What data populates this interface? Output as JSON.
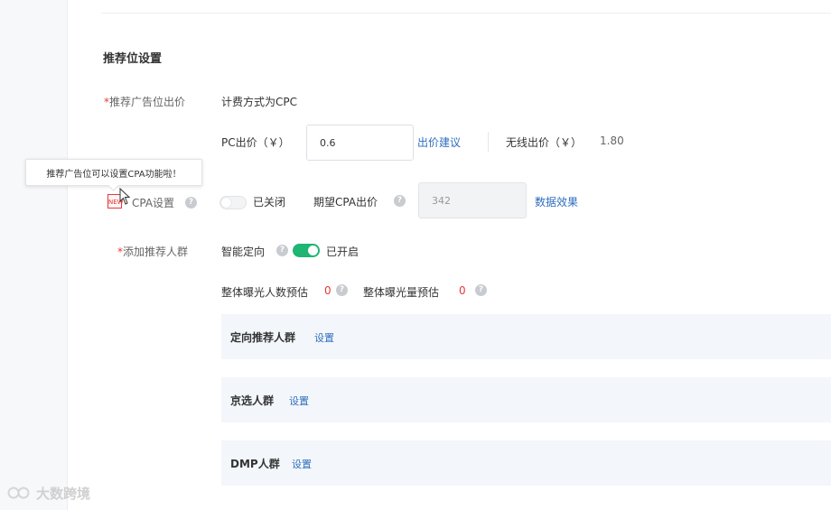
{
  "section_title": "推荐位设置",
  "bid_row": {
    "required_mark": "*",
    "label": "推荐广告位出价",
    "billing_text": "计费方式为CPC",
    "pc_label": "PC出价（￥）",
    "pc_value": "0.6",
    "bid_suggestion_link": "出价建议",
    "wireless_label": "无线出价（￥）",
    "wireless_value": "1.80"
  },
  "tooltip": {
    "text": "推荐广告位可以设置CPA功能啦！"
  },
  "cpa_row": {
    "badge_text": "NEW",
    "label": "CPA设置",
    "help_icon": "question-circle-icon",
    "toggle_state": "off",
    "toggle_text": "已关闭",
    "expected_label": "期望CPA出价",
    "expected_value": "342",
    "data_link": "数据效果"
  },
  "crowd_row": {
    "required_mark": "*",
    "label": "添加推荐人群",
    "smart_label": "智能定向",
    "toggle_state": "on",
    "toggle_text": "已开启",
    "estimate_people_label": "整体曝光人数预估",
    "estimate_people_value": "0",
    "estimate_exposure_label": "整体曝光量预估",
    "estimate_exposure_value": "0"
  },
  "panels": [
    {
      "title": "定向推荐人群",
      "link": "设置"
    },
    {
      "title": "京选人群",
      "link": "设置"
    },
    {
      "title": "DMP人群",
      "link": "设置"
    }
  ],
  "watermark": {
    "text": "大数跨境"
  },
  "colors": {
    "accent_link": "#2f6ebd",
    "required_red": "#e4393c",
    "toggle_on": "#1fb573",
    "panel_bg": "#f3f6fa"
  }
}
